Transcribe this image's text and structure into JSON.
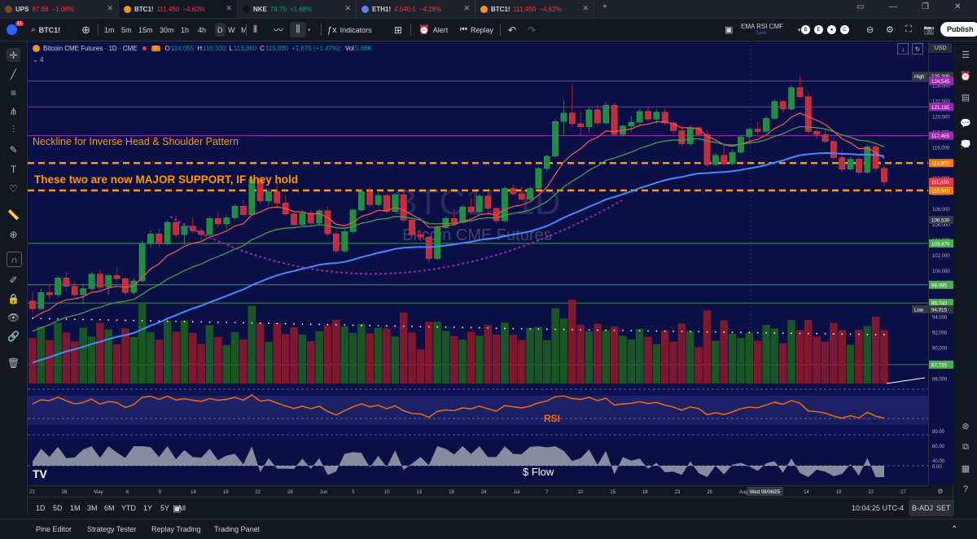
{
  "tabs": [
    {
      "symbol": "UPS",
      "price": "87.88",
      "change": "−1.06%",
      "dir": "neg",
      "icon_color": "#7a4b1c"
    },
    {
      "symbol": "BTC1!",
      "price": "111,450",
      "change": "−4.62%",
      "dir": "neg",
      "icon_color": "#f7931a",
      "active": true
    },
    {
      "symbol": "NKE",
      "price": "79.70",
      "change": "+1.68%",
      "dir": "pos",
      "icon_color": "#111111"
    },
    {
      "symbol": "ETH1!",
      "price": "4,640.5",
      "change": "−4.28%",
      "dir": "neg",
      "icon_color": "#627eea"
    },
    {
      "symbol": "BTC1!",
      "price": "111,450",
      "change": "−4.62%",
      "dir": "neg",
      "icon_color": "#f7931a"
    }
  ],
  "toolbar": {
    "avatar_badge": "11",
    "symbol": "BTC1!",
    "intervals": [
      "1m",
      "5m",
      "15m",
      "30m",
      "1h",
      "4h",
      "D",
      "W",
      "M"
    ],
    "active_interval": "D",
    "indicators_label": "Indicators",
    "alert_label": "Alert",
    "replay_label": "Replay",
    "layout_name": "EMA RSI CMF",
    "layout_sub": "Save",
    "publish_label": "Publish"
  },
  "legend": {
    "title": "Bitcoin CME Futures · 1D · CME",
    "badge": "D",
    "ohlc": {
      "o": "114,055",
      "h": "116,330",
      "l": "113,860",
      "c": "115,830",
      "chg": "+1,675 (+1.47%)"
    },
    "volume": "5.86K",
    "indicator_count": "4"
  },
  "annotations": {
    "neckline": "Neckline for Inverse Head & Shoulder Pattern",
    "support": "These two  are now MAJOR SUPPORT, IF they hold",
    "rsi": "RSI",
    "flow": "$ Flow"
  },
  "watermark": {
    "symbol": "BTC1!, 1D",
    "name": "Bitcoin CME Futures"
  },
  "price_axis": {
    "ticks": [
      "124,000",
      "122,000",
      "120,000",
      "118,000",
      "116,000",
      "114,000",
      "112,000",
      "110,000",
      "108,000",
      "106,000",
      "104,000",
      "102,000",
      "100,000",
      "98,000",
      "96,000",
      "94,000",
      "92,000",
      "90,000",
      "88,000",
      "86,000"
    ],
    "labels": [
      {
        "text": "125,200",
        "kind": "high",
        "bg": "#363a45",
        "tag": "High"
      },
      {
        "text": "124,545",
        "kind": "level",
        "bg": "#9c27b0"
      },
      {
        "text": "121,185",
        "kind": "level",
        "bg": "#9c27b0"
      },
      {
        "text": "117,455",
        "kind": "level",
        "bg": "#9c27b0"
      },
      {
        "text": "113,900",
        "kind": "level",
        "bg": "#f57c00"
      },
      {
        "text": "111,450",
        "kind": "level",
        "bg": "#f23645"
      },
      {
        "text": "110,345",
        "kind": "level",
        "bg": "#f57c00"
      },
      {
        "text": "106,530",
        "kind": "level",
        "bg": "#363a45"
      },
      {
        "text": "103,470",
        "kind": "level",
        "bg": "#4caf50"
      },
      {
        "text": "98,095",
        "kind": "level",
        "bg": "#4caf50"
      },
      {
        "text": "95,740",
        "kind": "level",
        "bg": "#4caf50"
      },
      {
        "text": "94,915",
        "kind": "low",
        "bg": "#363a45",
        "tag": "Low"
      },
      {
        "text": "87,735",
        "kind": "level",
        "bg": "#4caf50"
      }
    ],
    "rsi_ticks": [
      "80.00",
      "60.00",
      "40.00"
    ],
    "flow_ticks": [
      "0.00"
    ],
    "currency": "USD"
  },
  "time_axis": {
    "labels": [
      "23",
      "28",
      "May",
      "6",
      "9",
      "14",
      "19",
      "22",
      "28",
      "Jun",
      "5",
      "10",
      "13",
      "18",
      "24",
      "Jul",
      "7",
      "10",
      "15",
      "18",
      "23",
      "28",
      "Aug",
      "11",
      "14",
      "19",
      "22",
      "27"
    ],
    "crosshair_date": "Wed 08/06/25"
  },
  "bottom": {
    "ranges": [
      "1D",
      "5D",
      "1M",
      "3M",
      "6M",
      "YTD",
      "1Y",
      "5Y",
      "All"
    ],
    "clock": "10:04:25 UTC-4",
    "adj": "B-ADJ",
    "set": "SET"
  },
  "panels": [
    "Pine Editor",
    "Strategy Tester",
    "Replay Trading",
    "Trading Panel"
  ],
  "chart_data": {
    "type": "candlestick",
    "title": "Bitcoin CME Futures · 1D · CME",
    "ylim": [
      85500,
      126500
    ],
    "candles": [
      [
        96000,
        97200,
        94400,
        95000
      ],
      [
        95000,
        97600,
        94800,
        97100
      ],
      [
        97100,
        98200,
        96200,
        96800
      ],
      [
        96800,
        99300,
        96500,
        99000
      ],
      [
        99000,
        99800,
        97300,
        97900
      ],
      [
        97900,
        98600,
        96300,
        96800
      ],
      [
        96800,
        98200,
        95600,
        97600
      ],
      [
        97600,
        99800,
        97400,
        99500
      ],
      [
        99500,
        100100,
        97400,
        97800
      ],
      [
        97800,
        99600,
        96800,
        99300
      ],
      [
        99300,
        100400,
        98600,
        98900
      ],
      [
        98900,
        99100,
        96700,
        97100
      ],
      [
        97100,
        99000,
        96800,
        98600
      ],
      [
        98600,
        103800,
        98400,
        103500
      ],
      [
        103500,
        105200,
        102900,
        104700
      ],
      [
        104700,
        105300,
        103000,
        103400
      ],
      [
        103400,
        106500,
        103200,
        106200
      ],
      [
        106200,
        107100,
        104300,
        104600
      ],
      [
        104600,
        106100,
        103300,
        105700
      ],
      [
        105700,
        106900,
        104800,
        105100
      ],
      [
        105100,
        105500,
        103900,
        104600
      ],
      [
        104600,
        107000,
        104400,
        106700
      ],
      [
        106700,
        107600,
        105600,
        106000
      ],
      [
        106000,
        107200,
        105300,
        106800
      ],
      [
        106800,
        108600,
        106500,
        108300
      ],
      [
        108300,
        109000,
        106900,
        107200
      ],
      [
        107200,
        112100,
        107000,
        111800
      ],
      [
        111800,
        112400,
        108600,
        109000
      ],
      [
        109000,
        110600,
        108400,
        110200
      ],
      [
        110200,
        111500,
        108300,
        108700
      ],
      [
        108700,
        109700,
        107000,
        107300
      ],
      [
        107300,
        107700,
        105600,
        105900
      ],
      [
        105900,
        107800,
        105700,
        107400
      ],
      [
        107400,
        107800,
        105600,
        106100
      ],
      [
        106100,
        107900,
        105900,
        107700
      ],
      [
        107700,
        108200,
        104400,
        104700
      ],
      [
        104700,
        105100,
        102100,
        102500
      ],
      [
        102500,
        105400,
        102300,
        105000
      ],
      [
        105000,
        108000,
        104800,
        107800
      ],
      [
        107800,
        110500,
        107600,
        110200
      ],
      [
        110200,
        110800,
        108200,
        108500
      ],
      [
        108500,
        110100,
        108300,
        109700
      ],
      [
        109700,
        110000,
        107300,
        107600
      ],
      [
        107600,
        110000,
        107400,
        109800
      ],
      [
        109800,
        110500,
        106200,
        106500
      ],
      [
        106500,
        106900,
        104300,
        104600
      ],
      [
        104600,
        105100,
        103800,
        104300
      ],
      [
        104300,
        104500,
        101000,
        101500
      ],
      [
        101500,
        105800,
        101300,
        105500
      ],
      [
        105500,
        107000,
        105300,
        106700
      ],
      [
        106700,
        107900,
        105900,
        106200
      ],
      [
        106200,
        108500,
        106000,
        108200
      ],
      [
        108200,
        109300,
        107300,
        107600
      ],
      [
        107600,
        109900,
        107400,
        109600
      ],
      [
        109600,
        110100,
        107700,
        108000
      ],
      [
        108000,
        108200,
        106100,
        106400
      ],
      [
        106400,
        110900,
        106200,
        110600
      ],
      [
        110600,
        111100,
        109600,
        109900
      ],
      [
        109900,
        110800,
        109000,
        109200
      ],
      [
        109200,
        110900,
        109000,
        110600
      ],
      [
        110600,
        113400,
        110400,
        113200
      ],
      [
        113200,
        115000,
        112800,
        114800
      ],
      [
        114800,
        119600,
        114600,
        119300
      ],
      [
        119300,
        122000,
        117400,
        120400
      ],
      [
        120400,
        124200,
        118600,
        119000
      ],
      [
        119000,
        120600,
        117400,
        118600
      ],
      [
        118600,
        121100,
        117800,
        120800
      ],
      [
        120800,
        121500,
        118700,
        119100
      ],
      [
        119100,
        121800,
        118900,
        121400
      ],
      [
        121400,
        121700,
        117300,
        117600
      ],
      [
        117600,
        118900,
        117300,
        118700
      ],
      [
        118700,
        120000,
        117900,
        119200
      ],
      [
        119200,
        120900,
        118900,
        120600
      ],
      [
        120600,
        121200,
        119300,
        119600
      ],
      [
        119600,
        120900,
        119000,
        120500
      ],
      [
        120500,
        121000,
        118800,
        119100
      ],
      [
        119100,
        119400,
        117700,
        118100
      ],
      [
        118100,
        118600,
        116000,
        116400
      ],
      [
        116400,
        118800,
        116200,
        118500
      ],
      [
        118500,
        118700,
        117300,
        117600
      ],
      [
        117600,
        118200,
        113400,
        113700
      ],
      [
        113700,
        115200,
        113500,
        114900
      ],
      [
        114900,
        116400,
        113500,
        113800
      ],
      [
        113800,
        115700,
        113600,
        115300
      ],
      [
        115300,
        117600,
        115100,
        117300
      ],
      [
        117300,
        118500,
        116800,
        118300
      ],
      [
        118300,
        119200,
        117600,
        118000
      ],
      [
        118000,
        120000,
        117800,
        119700
      ],
      [
        119700,
        122200,
        119500,
        121900
      ],
      [
        121900,
        122100,
        120400,
        120900
      ],
      [
        120900,
        124000,
        120700,
        123700
      ],
      [
        123700,
        125200,
        122300,
        122500
      ],
      [
        122500,
        123000,
        117700,
        118000
      ],
      [
        118000,
        118500,
        117000,
        117600
      ],
      [
        117600,
        118200,
        116400,
        116700
      ],
      [
        116700,
        117200,
        114400,
        114600
      ],
      [
        114600,
        115600,
        112800,
        113100
      ],
      [
        113100,
        114700,
        112900,
        114400
      ],
      [
        114400,
        114700,
        112400,
        112700
      ],
      [
        112700,
        116300,
        112500,
        116000
      ],
      [
        116000,
        116300,
        112800,
        113200
      ],
      [
        113200,
        113600,
        110900,
        111450
      ]
    ]
  }
}
